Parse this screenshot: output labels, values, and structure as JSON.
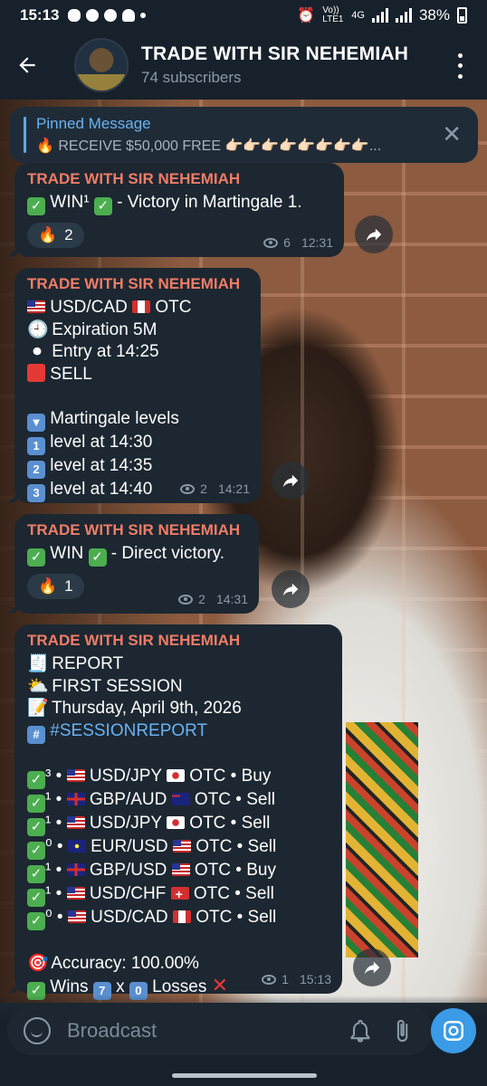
{
  "status_bar": {
    "time": "15:13",
    "network_label": "Vo)) LTE1",
    "network_type": "4G",
    "battery": "38%"
  },
  "header": {
    "title": "TRADE WITH SIR NEHEMIAH",
    "subtitle": "74 subscribers",
    "back_icon": "arrow-left-icon",
    "menu_icon": "more-vert-icon"
  },
  "pinned": {
    "title": "Pinned Message",
    "text": "🔥 RECEIVE $50,000 FREE 👉🏻👉🏻👉🏻👉🏻👉🏻👉🏻👉🏻👉🏻..."
  },
  "messages": [
    {
      "sender": "TRADE WITH SIR NEHEMIAH",
      "text": "WIN¹",
      "text_tail": "- Victory in Martingale 1.",
      "reaction": {
        "emoji": "🔥",
        "count": "2"
      },
      "views": "6",
      "time": "12:31"
    },
    {
      "sender": "TRADE WITH SIR NEHEMIAH",
      "pair": "USD/CAD",
      "pair_suffix": "OTC",
      "expiration": "Expiration 5M",
      "entry": "Entry at 14:25",
      "direction": "SELL",
      "martingale_title": "Martingale levels",
      "levels": [
        "level at 14:30",
        "level at 14:35",
        "level at 14:40"
      ],
      "level_nums": [
        "1",
        "2",
        "3"
      ],
      "views": "2",
      "time": "14:21"
    },
    {
      "sender": "TRADE WITH SIR NEHEMIAH",
      "text": "WIN",
      "text_tail": "- Direct victory.",
      "reaction": {
        "emoji": "🔥",
        "count": "1"
      },
      "views": "2",
      "time": "14:31"
    },
    {
      "sender": "TRADE WITH SIR NEHEMIAH",
      "report_title": "REPORT",
      "session": "FIRST SESSION",
      "date": "Thursday, April 9th, 2026",
      "hashtag": "#SESSIONREPORT",
      "trades": [
        {
          "mark": "³",
          "flag1": "us",
          "base": "USD/JPY",
          "flag2": "jp",
          "rest": "OTC • Buy"
        },
        {
          "mark": "¹",
          "flag1": "gb",
          "base": "GBP/AUD",
          "flag2": "au",
          "rest": "OTC • Sell"
        },
        {
          "mark": "¹",
          "flag1": "us",
          "base": "USD/JPY",
          "flag2": "jp",
          "rest": "OTC • Sell"
        },
        {
          "mark": "⁰",
          "flag1": "eu",
          "base": "EUR/USD",
          "flag2": "us",
          "rest": "OTC • Sell"
        },
        {
          "mark": "¹",
          "flag1": "gb",
          "base": "GBP/USD",
          "flag2": "us",
          "rest": "OTC • Buy"
        },
        {
          "mark": "¹",
          "flag1": "us",
          "base": "USD/CHF",
          "flag2": "ch",
          "rest": "OTC • Sell"
        },
        {
          "mark": "⁰",
          "flag1": "us",
          "base": "USD/CAD",
          "flag2": "ca",
          "rest": "OTC • Sell"
        }
      ],
      "accuracy": "Accuracy: 100.00%",
      "wins_label": "Wins",
      "wins": "7",
      "x": "x",
      "losses": "0",
      "losses_label": "Losses",
      "views": "1",
      "time": "15:13"
    }
  ],
  "composer": {
    "placeholder": "Broadcast"
  },
  "colors": {
    "sender": "#f07c66",
    "link": "#6ab2f2",
    "bubble": "#1c2731",
    "accent": "#3b9be6"
  }
}
